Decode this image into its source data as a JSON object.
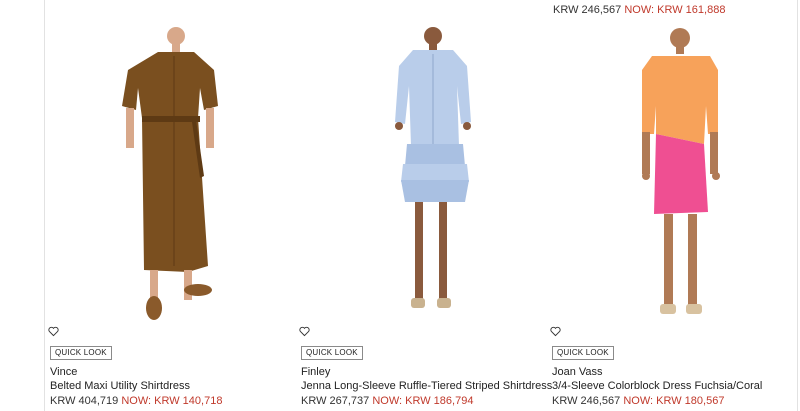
{
  "top_price": {
    "original": "KRW 246,567",
    "now": "NOW: KRW 161,888"
  },
  "products": [
    {
      "quick_look": "QUICK LOOK",
      "designer": "Vince",
      "name": "Belted Maxi Utility Shirtdress",
      "price_original": "KRW 404,719",
      "price_now": "NOW: KRW 140,718",
      "colors": {
        "dress": "#7a4f1f",
        "skin": "#d8a88a"
      }
    },
    {
      "quick_look": "QUICK LOOK",
      "designer": "Finley",
      "name": "Jenna Long-Sleeve Ruffle-Tiered Striped Shirtdress",
      "price_original": "KRW 267,737",
      "price_now": "NOW: KRW 186,794",
      "colors": {
        "dress": "#b9cdea",
        "skin": "#8a5a3d"
      }
    },
    {
      "quick_look": "QUICK LOOK",
      "designer": "Joan Vass",
      "name": "3/4-Sleeve Colorblock Dress Fuchsia/Coral",
      "price_original": "KRW 246,567",
      "price_now": "NOW: KRW 180,567",
      "colors": {
        "top": "#f7a25a",
        "skirt": "#ef4f92",
        "skin": "#b07a55"
      }
    }
  ],
  "colors": {
    "sale_price": "#c0392b"
  }
}
